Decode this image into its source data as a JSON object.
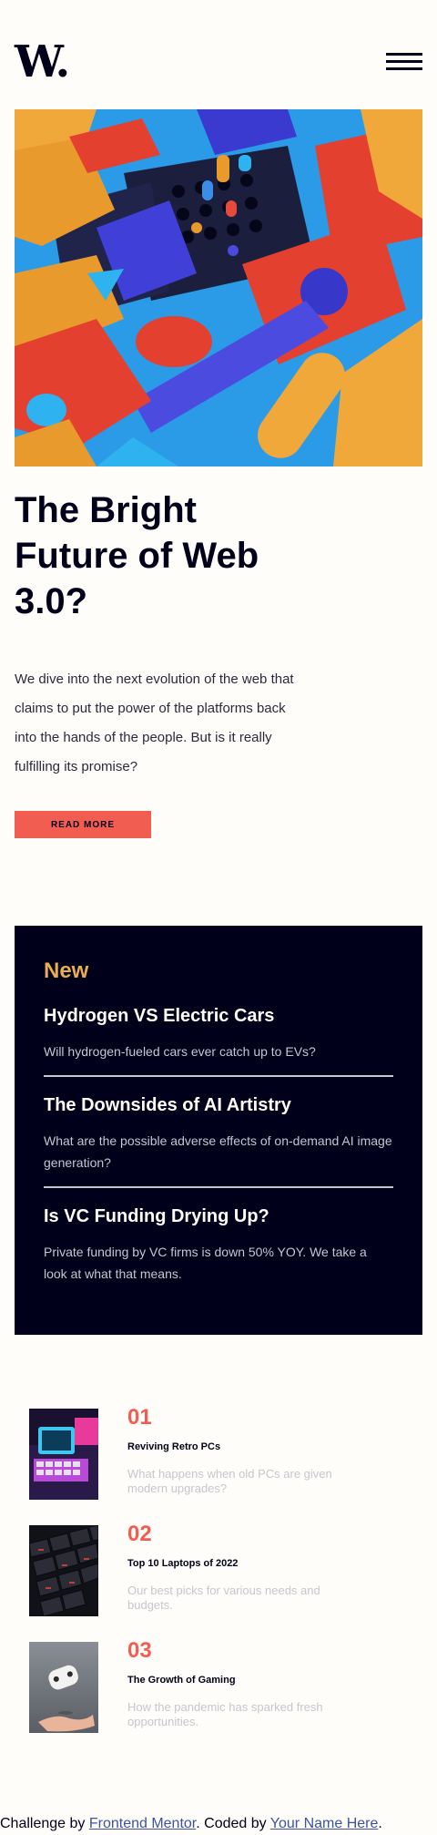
{
  "header": {
    "logo_text": "W",
    "logo_dot": "."
  },
  "hero": {
    "title": "The Bright Future of Web 3.0?",
    "text": "We dive into the next evolution of the web that claims to put the power of the platforms back into the hands of the people. But is it really fulfilling its promise?",
    "button_label": "READ MORE"
  },
  "new_section": {
    "heading": "New",
    "items": [
      {
        "title": "Hydrogen VS Electric Cars",
        "desc": "Will hydrogen-fueled cars ever catch up to EVs?"
      },
      {
        "title": "The Downsides of AI Artistry",
        "desc": "What are the possible adverse effects of on-demand AI image generation?"
      },
      {
        "title": "Is VC Funding Drying Up?",
        "desc": "Private funding by VC firms is down 50% YOY. We take a look at what that means."
      }
    ]
  },
  "top_list": [
    {
      "num": "01",
      "title": "Reviving Retro PCs",
      "desc": "What happens when old PCs are given modern upgrades?"
    },
    {
      "num": "02",
      "title": "Top 10 Laptops of 2022",
      "desc": "Our best picks for various needs and budgets."
    },
    {
      "num": "03",
      "title": "The Growth of Gaming",
      "desc": "How the pandemic has sparked fresh opportunities."
    }
  ],
  "footer": {
    "prefix": "Challenge by ",
    "link1": "Frontend Mentor",
    "middle": ". Coded by ",
    "link2": "Your Name Here",
    "suffix": "."
  },
  "colors": {
    "accent_red": "#f15d51",
    "accent_orange": "#e9ab53",
    "dark_navy": "#00001a",
    "off_white": "#fffdf9"
  }
}
